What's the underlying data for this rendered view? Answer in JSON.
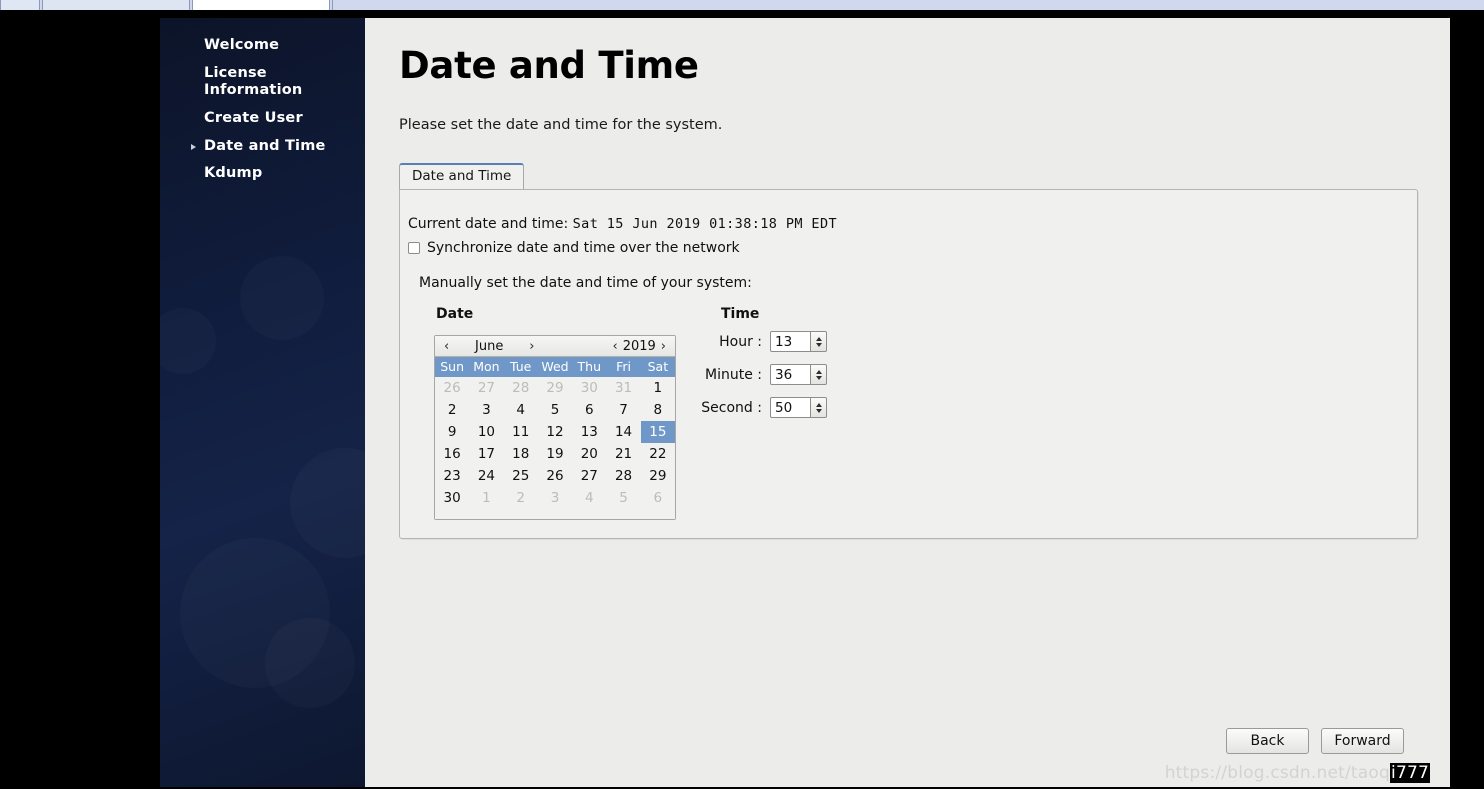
{
  "sidebar": {
    "items": [
      {
        "label": "Welcome",
        "active": false
      },
      {
        "label": "License Information",
        "active": false
      },
      {
        "label": "Create User",
        "active": false
      },
      {
        "label": "Date and Time",
        "active": true
      },
      {
        "label": "Kdump",
        "active": false
      }
    ]
  },
  "page": {
    "title": "Date and Time",
    "subtitle": "Please set the date and time for the system."
  },
  "tabs": [
    {
      "label": "Date and Time",
      "active": true
    }
  ],
  "panel": {
    "current_datetime_label": "Current date and time:",
    "current_datetime_value": "Sat 15 Jun 2019 01:38:18 PM EDT",
    "sync_label": "Synchronize date and time over the network",
    "sync_checked": false,
    "manual_label": "Manually set the date and time of your system:",
    "date_heading": "Date",
    "time_heading": "Time"
  },
  "calendar": {
    "prev_month_icon": "‹",
    "next_month_icon": "›",
    "prev_year_icon": "‹",
    "next_year_icon": "›",
    "month": "June",
    "year": "2019",
    "weekdays": [
      "Sun",
      "Mon",
      "Tue",
      "Wed",
      "Thu",
      "Fri",
      "Sat"
    ],
    "selected_day": 15,
    "weeks": [
      [
        {
          "d": "26",
          "muted": true
        },
        {
          "d": "27",
          "muted": true
        },
        {
          "d": "28",
          "muted": true
        },
        {
          "d": "29",
          "muted": true
        },
        {
          "d": "30",
          "muted": true
        },
        {
          "d": "31",
          "muted": true
        },
        {
          "d": "1",
          "muted": false
        }
      ],
      [
        {
          "d": "2",
          "muted": false
        },
        {
          "d": "3",
          "muted": false
        },
        {
          "d": "4",
          "muted": false
        },
        {
          "d": "5",
          "muted": false
        },
        {
          "d": "6",
          "muted": false
        },
        {
          "d": "7",
          "muted": false
        },
        {
          "d": "8",
          "muted": false
        }
      ],
      [
        {
          "d": "9",
          "muted": false
        },
        {
          "d": "10",
          "muted": false
        },
        {
          "d": "11",
          "muted": false
        },
        {
          "d": "12",
          "muted": false
        },
        {
          "d": "13",
          "muted": false
        },
        {
          "d": "14",
          "muted": false
        },
        {
          "d": "15",
          "muted": false,
          "selected": true
        }
      ],
      [
        {
          "d": "16",
          "muted": false
        },
        {
          "d": "17",
          "muted": false
        },
        {
          "d": "18",
          "muted": false
        },
        {
          "d": "19",
          "muted": false
        },
        {
          "d": "20",
          "muted": false
        },
        {
          "d": "21",
          "muted": false
        },
        {
          "d": "22",
          "muted": false
        }
      ],
      [
        {
          "d": "23",
          "muted": false
        },
        {
          "d": "24",
          "muted": false
        },
        {
          "d": "25",
          "muted": false
        },
        {
          "d": "26",
          "muted": false
        },
        {
          "d": "27",
          "muted": false
        },
        {
          "d": "28",
          "muted": false
        },
        {
          "d": "29",
          "muted": false
        }
      ],
      [
        {
          "d": "30",
          "muted": false
        },
        {
          "d": "1",
          "muted": true
        },
        {
          "d": "2",
          "muted": true
        },
        {
          "d": "3",
          "muted": true
        },
        {
          "d": "4",
          "muted": true
        },
        {
          "d": "5",
          "muted": true
        },
        {
          "d": "6",
          "muted": true
        }
      ]
    ]
  },
  "time": {
    "hour_label": "Hour :",
    "hour_value": "13",
    "minute_label": "Minute :",
    "minute_value": "36",
    "second_label": "Second :",
    "second_value": "50"
  },
  "footer": {
    "back_label": "Back",
    "forward_label": "Forward"
  },
  "watermark": {
    "text": "https://blog.csdn.net/taoq",
    "tail": "i777"
  },
  "colors": {
    "accent_blue": "#6f98c9",
    "tab_accent": "#5a7fb5",
    "sidebar_dark": "#101c3c",
    "panel_bg": "#f0f0ee",
    "window_bg": "#ececeb"
  }
}
